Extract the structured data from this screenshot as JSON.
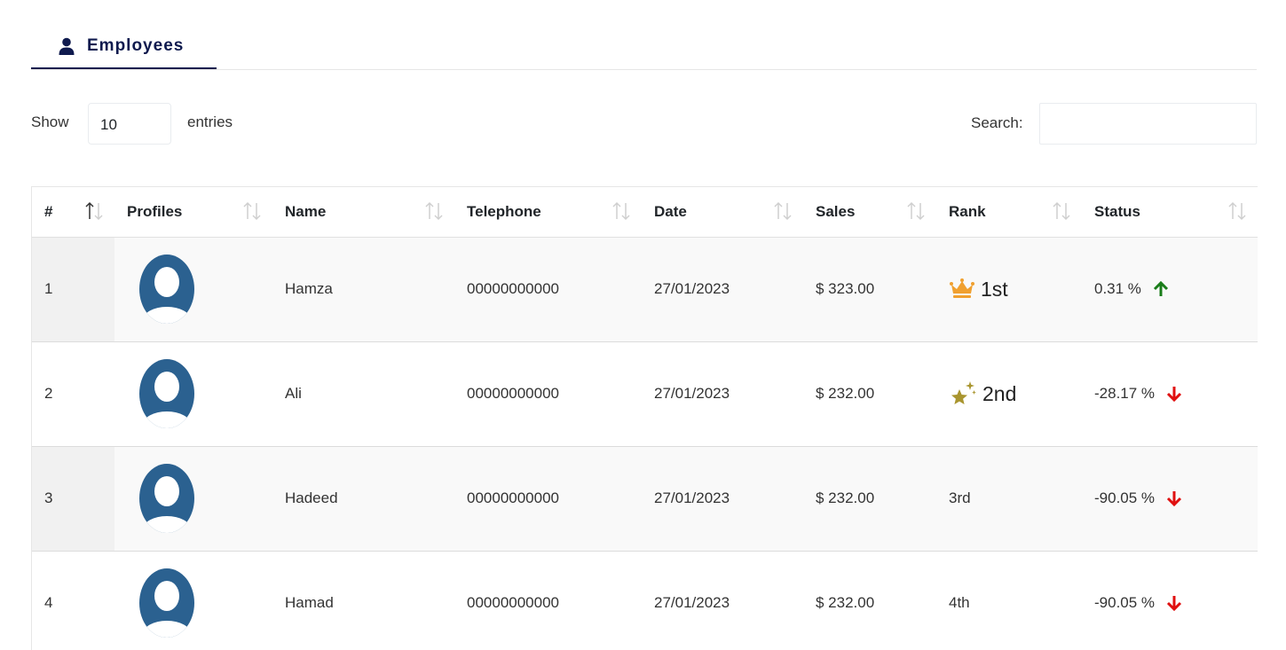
{
  "tabs": [
    {
      "label": "Employees",
      "icon": "user-icon",
      "active": true
    }
  ],
  "controls": {
    "show_label": "Show",
    "entries_value": "10",
    "entries_label": "entries",
    "search_label": "Search:",
    "search_value": ""
  },
  "table": {
    "headers": [
      "#",
      "Profiles",
      "Name",
      "Telephone",
      "Date",
      "Sales",
      "Rank",
      "Status"
    ],
    "rows": [
      {
        "num": "1",
        "name": "Hamza",
        "telephone": "00000000000",
        "date": "27/01/2023",
        "sales": "$ 323.00",
        "rank": "1st",
        "rank_icon": "crown-icon",
        "status": "0.31 %",
        "trend": "up"
      },
      {
        "num": "2",
        "name": "Ali",
        "telephone": "00000000000",
        "date": "27/01/2023",
        "sales": "$ 232.00",
        "rank": "2nd",
        "rank_icon": "sparkle-star-icon",
        "status": "-28.17 %",
        "trend": "down"
      },
      {
        "num": "3",
        "name": "Hadeed",
        "telephone": "00000000000",
        "date": "27/01/2023",
        "sales": "$ 232.00",
        "rank": "3rd",
        "rank_icon": "",
        "status": "-90.05 %",
        "trend": "down"
      },
      {
        "num": "4",
        "name": "Hamad",
        "telephone": "00000000000",
        "date": "27/01/2023",
        "sales": "$ 232.00",
        "rank": "4th",
        "rank_icon": "",
        "status": "-90.05 %",
        "trend": "down"
      }
    ]
  },
  "colors": {
    "tab_text": "#0f1a4e",
    "avatar": "#2b6190",
    "crown": "#f0a030",
    "star": "#a9952f",
    "up_arrow": "#1a7d1a",
    "down_arrow": "#e01010"
  }
}
